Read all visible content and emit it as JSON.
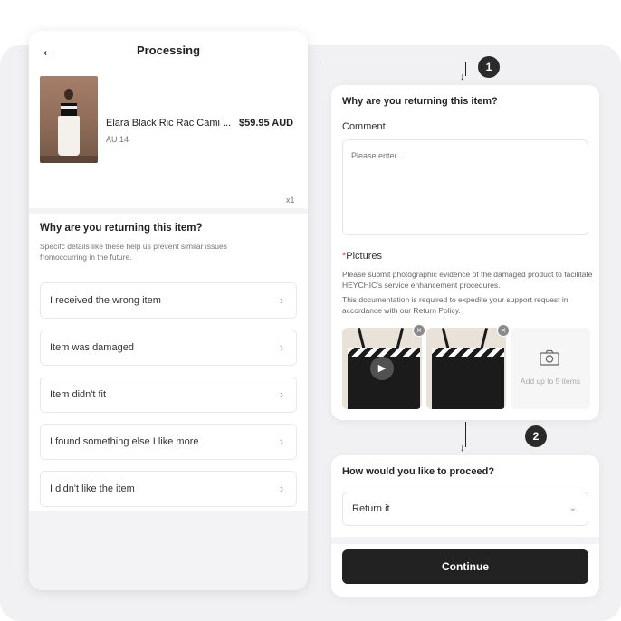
{
  "left_screen": {
    "header": {
      "back_icon": "arrow-left-icon",
      "title": "Processing"
    },
    "product": {
      "name": "Elara Black Ric Rac Cami ...",
      "price": "$59.95 AUD",
      "size": "AU 14",
      "quantity": "x1"
    },
    "reasons": {
      "title": "Why are you returning this item?",
      "description": "Specifc details like these help us prevent similar issues fromoccurring in the future.",
      "items": [
        {
          "label": "I received the wrong item"
        },
        {
          "label": "Item was damaged"
        },
        {
          "label": "Item didn't fit"
        },
        {
          "label": "I found something else I like more"
        },
        {
          "label": "I didn't like the item"
        }
      ]
    }
  },
  "steps": {
    "step1": "1",
    "step2": "2"
  },
  "detail_card": {
    "title": "Why are you returning this item?",
    "comment_label": "Comment",
    "comment_placeholder": "Please enter ...",
    "pictures_required_mark": "*",
    "pictures_label": "Pictures",
    "pictures_desc_1": "Please submit photographic evidence of the damaged product to facilitate HEYCHIC's service enhancement procedures.",
    "pictures_desc_2": "This documentation is required to expedite your support request in accordance with our Return Policy.",
    "add_label": "Add up to 5 items"
  },
  "proceed_card": {
    "title": "How would you like to proceed?",
    "selected_option": "Return it",
    "continue_label": "Continue"
  }
}
